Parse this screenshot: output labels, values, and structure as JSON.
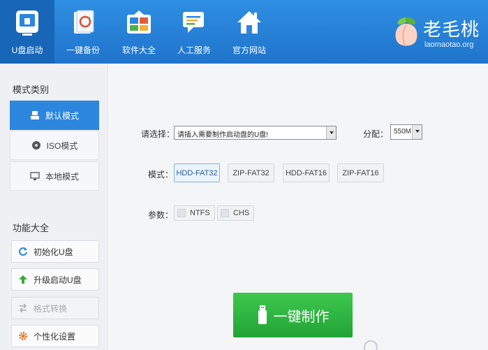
{
  "nav": {
    "items": [
      {
        "label": "U盘启动",
        "icon": "usb-drive-icon",
        "active": true
      },
      {
        "label": "一键备份",
        "icon": "backup-icon",
        "active": false
      },
      {
        "label": "软件大全",
        "icon": "software-icon",
        "active": false
      },
      {
        "label": "人工服务",
        "icon": "chat-icon",
        "active": false
      },
      {
        "label": "官方网站",
        "icon": "home-icon",
        "active": false
      }
    ]
  },
  "brand": {
    "name": "老毛桃",
    "site": "laomaotao.org",
    "icon": "peach-logo"
  },
  "sidebar": {
    "mode_title": "模式类别",
    "modes": [
      {
        "label": "默认模式",
        "icon": "user-icon",
        "active": true
      },
      {
        "label": "ISO模式",
        "icon": "disc-icon",
        "active": false
      },
      {
        "label": "本地模式",
        "icon": "monitor-icon",
        "active": false
      }
    ],
    "func_title": "功能大全",
    "functions": [
      {
        "label": "初始化U盘",
        "icon": "refresh-icon",
        "disabled": false
      },
      {
        "label": "升级启动U盘",
        "icon": "up-arrow-icon",
        "disabled": false
      },
      {
        "label": "格式转换",
        "icon": "convert-icon",
        "disabled": true
      },
      {
        "label": "个性化设置",
        "icon": "gear-icon",
        "disabled": false
      }
    ]
  },
  "main": {
    "select_label": "请选择：",
    "select_value": "请插入需要制作启动盘的U盘!",
    "alloc_label": "分配：",
    "alloc_value": "550M",
    "mode_label": "模式：",
    "mode_options": [
      "HDD-FAT32",
      "ZIP-FAT32",
      "HDD-FAT16",
      "ZIP-FAT16"
    ],
    "param_label": "参数：",
    "params": [
      "NTFS",
      "CHS"
    ],
    "make_button": "一键制作"
  },
  "colors": {
    "top_bar": "#2580d8",
    "accent": "#2c86de",
    "make_button": "#2fb543"
  }
}
